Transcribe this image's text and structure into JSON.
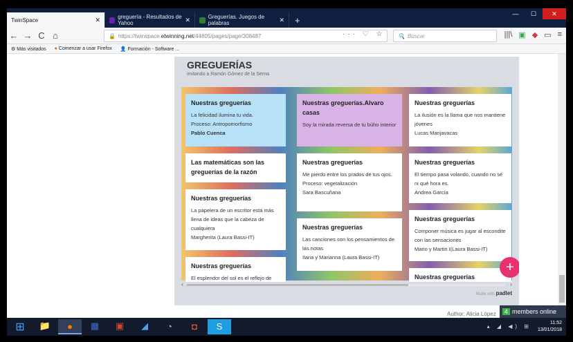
{
  "tabs": [
    {
      "label": "TwinSpace",
      "active": true,
      "color": "#ffffff"
    },
    {
      "label": "greguería - Resultados de Yahoo",
      "active": false,
      "color": "#6b1fb1"
    },
    {
      "label": "Greguerías. Juegos de palabras",
      "active": false,
      "color": "#2e7d32"
    }
  ],
  "newtab": "+",
  "nav": {
    "back": "←",
    "forward": "→",
    "reload": "C",
    "home": "⌂",
    "url_prefix": "https://twinspace.",
    "url_domain": "etwinning.net",
    "url_path": "/44605/pages/page/308487",
    "url_icons": "··· ♡ ☆",
    "search_placeholder": "Buscar",
    "tools": [
      "|||\\",
      "▣",
      "◆",
      "▭",
      "≡"
    ]
  },
  "bookmarks": [
    "Más visitados",
    "Comenzar a usar Firefox",
    "Formación - Software ..."
  ],
  "padlet": {
    "title": "GREGUERÍAS",
    "subtitle": "imitando a Ramón Gómez de la Serna",
    "made_with": "Made with",
    "brand": "padlet",
    "fab": "+"
  },
  "cards": [
    {
      "title": "Nuestras greguerías",
      "lines": [
        "La felicidad ilumina tu vida.",
        "Proceso: Antropomorfismo"
      ],
      "author": "Pablo Cuenca",
      "bg": "#b7e1f7"
    },
    {
      "title": "Nuestras greguerías.Alvaro casas",
      "lines": [
        "Soy la mirada reversa  de tu búho interior"
      ],
      "author": "",
      "bg": "#d9b3e6"
    },
    {
      "title": "Nuestras greguerías",
      "lines": [
        "La ilusión es la llama que nos mantiene jóvenes",
        "Lucas Manjavacas"
      ],
      "author": "",
      "bg": "#ffffff"
    },
    {
      "title": "Las matemáticas son las greguerías de la razón",
      "lines": [],
      "author": "",
      "bg": "#ffffff"
    },
    {
      "title": "Nuestras greguerías",
      "lines": [
        "Me pierdo entre los prados de tus ojos.",
        "Proceso: vegetalización",
        "Sara Bascuñana"
      ],
      "author": "",
      "bg": "#ffffff"
    },
    {
      "title": "Nuestras greguerías",
      "lines": [
        "El tiempo pasa volando, cuando no sé ni qué hora es.",
        "Andrea García"
      ],
      "author": "",
      "bg": "#ffffff"
    },
    {
      "title": "Nuestras greguerías",
      "lines": [
        "La papelera de un escritor está más llena de ideas que la cabeza de cualquiera",
        "Margherita (Laura Bassi-IT)"
      ],
      "author": "",
      "bg": "#ffffff"
    },
    {
      "title": "Nuestras greguerías",
      "lines": [
        "Las canciones son los pensamientos de las notas",
        "Ilaria y Marianna (Laura Bassi-IT)"
      ],
      "author": "",
      "bg": "#ffffff"
    },
    {
      "title": "Nuestras greguerías",
      "lines": [
        "Componer música es jugar al escondite con las sensaciones",
        "Mario y Martin I(Laura Bassi-IT)"
      ],
      "author": "",
      "bg": "#ffffff"
    },
    {
      "title": "Nuestras greguerías",
      "lines": [
        "El esplendor del sol es el reflejo de"
      ],
      "author": "",
      "bg": "#ffffff"
    },
    {
      "title": "Nuestras greguerías",
      "lines": [],
      "author": "",
      "bg": "#ffffff"
    }
  ],
  "footer": {
    "author": "Author: Alicia López",
    "members_count": "4",
    "members_label": "members online"
  },
  "taskbar": {
    "start": "⊞",
    "apps": [
      "📁",
      "●",
      "▦",
      "▣",
      "◢",
      "◔",
      "◘",
      "S"
    ],
    "time": "11:52",
    "date": "13/01/2018",
    "tray": "▴ ◢ ◀) ⊞"
  }
}
